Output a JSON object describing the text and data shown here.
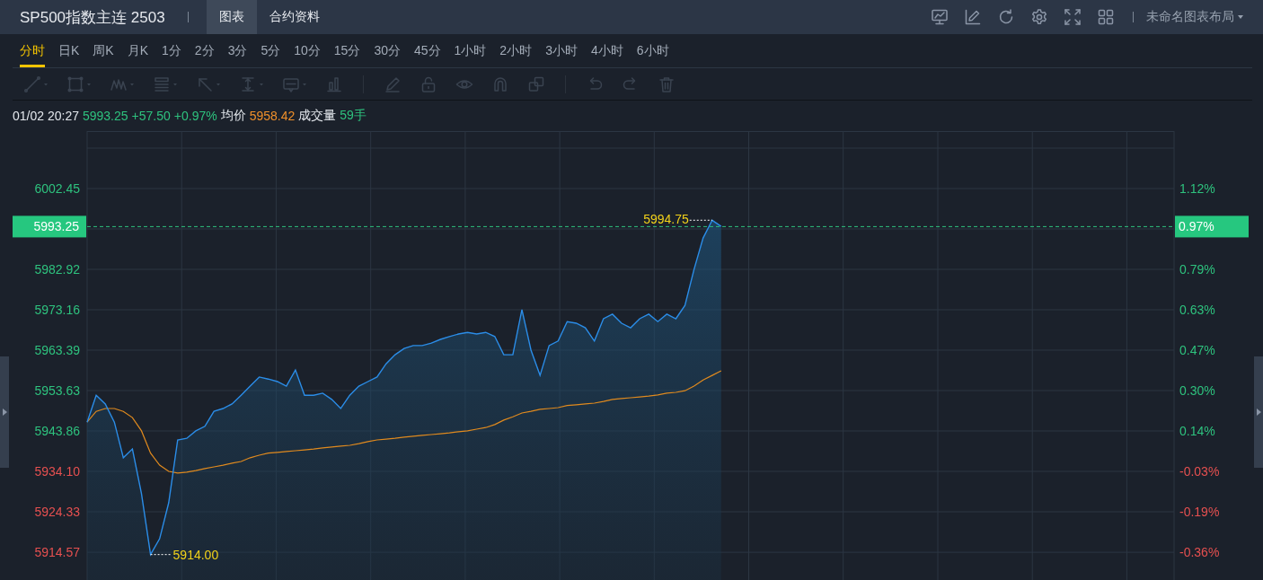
{
  "header": {
    "title": "SP500指数主连 2503",
    "tabs": [
      {
        "label": "图表",
        "selected": true
      },
      {
        "label": "合约资料",
        "selected": false
      }
    ],
    "tools": [
      {
        "kind": "monitor"
      },
      {
        "kind": "draw"
      },
      {
        "kind": "refresh"
      },
      {
        "kind": "settings"
      },
      {
        "kind": "fullscreen"
      },
      {
        "kind": "layout"
      }
    ],
    "layout_menu": "未命名图表布局"
  },
  "periods": [
    {
      "label": "分时",
      "selected": true
    },
    {
      "label": "日K",
      "selected": false
    },
    {
      "label": "周K",
      "selected": false
    },
    {
      "label": "月K",
      "selected": false
    },
    {
      "label": "1分",
      "selected": false
    },
    {
      "label": "2分",
      "selected": false
    },
    {
      "label": "3分",
      "selected": false
    },
    {
      "label": "5分",
      "selected": false
    },
    {
      "label": "10分",
      "selected": false
    },
    {
      "label": "15分",
      "selected": false
    },
    {
      "label": "30分",
      "selected": false
    },
    {
      "label": "45分",
      "selected": false
    },
    {
      "label": "1小时",
      "selected": false
    },
    {
      "label": "2小时",
      "selected": false
    },
    {
      "label": "3小时",
      "selected": false
    },
    {
      "label": "4小时",
      "selected": false
    },
    {
      "label": "6小时",
      "selected": false
    }
  ],
  "drawing_tools": [
    {
      "kind": "line",
      "menu": true
    },
    {
      "kind": "rect",
      "menu": true
    },
    {
      "kind": "wave",
      "menu": true
    },
    {
      "kind": "lines",
      "menu": true
    },
    {
      "kind": "arrow",
      "menu": true
    },
    {
      "kind": "measure",
      "menu": true
    },
    {
      "kind": "note",
      "menu": true
    },
    {
      "kind": "bars",
      "menu": false
    },
    {
      "kind": "divider"
    },
    {
      "kind": "pencil",
      "menu": false
    },
    {
      "kind": "lock",
      "menu": false
    },
    {
      "kind": "eye",
      "menu": false
    },
    {
      "kind": "magnet",
      "menu": false
    },
    {
      "kind": "copy",
      "menu": false
    },
    {
      "kind": "divider"
    },
    {
      "kind": "undo",
      "menu": false
    },
    {
      "kind": "redo",
      "menu": false
    },
    {
      "kind": "trash",
      "menu": false
    }
  ],
  "quote": [
    {
      "text": "01/02 20:27",
      "color": "#e3e7ec"
    },
    {
      "text": "5993.25",
      "color": "#2ec27e"
    },
    {
      "text": "+57.50",
      "color": "#2ec27e"
    },
    {
      "text": "+0.97%",
      "color": "#2ec27e"
    },
    {
      "text": "均价",
      "color": "#e3e7ec"
    },
    {
      "text": "5958.42",
      "color": "#f0902a"
    },
    {
      "text": "成交量",
      "color": "#e3e7ec"
    },
    {
      "text": "59手",
      "color": "#2ec27e"
    }
  ],
  "chart": {
    "chart_data": {
      "type": "area",
      "ylim": [
        5907.85,
        6016.34
      ],
      "grid": true,
      "categories": [
        null,
        null,
        null,
        null,
        null,
        null,
        null,
        null,
        null,
        null,
        null,
        null,
        null,
        null,
        null,
        null,
        null,
        null,
        null,
        null,
        null,
        null,
        null,
        null,
        null,
        null,
        null,
        null,
        null,
        null,
        null,
        null,
        null,
        null,
        null,
        null,
        null,
        null,
        null,
        null,
        null,
        null,
        null,
        null,
        null,
        null,
        null,
        null,
        null,
        null,
        null,
        null,
        null,
        null,
        null,
        null,
        null,
        null,
        null,
        null,
        null,
        null,
        null,
        null,
        null,
        null,
        null,
        null,
        null,
        null,
        null,
        null,
        null,
        null,
        null,
        null,
        null,
        null,
        null,
        null,
        null,
        null,
        null,
        null,
        null,
        null,
        null,
        null,
        null,
        null,
        null,
        null,
        null,
        null,
        null,
        null,
        null,
        null,
        null,
        null,
        null,
        null,
        null,
        null,
        null,
        null,
        null,
        null,
        null,
        null,
        null,
        null,
        null,
        null,
        null,
        null,
        null,
        null,
        null,
        null
      ],
      "series": [
        {
          "color": "#2b8de8",
          "type": "area",
          "values": [
            5946.0,
            5952.5,
            5950.4,
            5946.0,
            5937.4,
            5939.5,
            5928.7,
            5914.0,
            5917.8,
            5926.5,
            5941.7,
            5942.1,
            5943.9,
            5945.0,
            5948.6,
            5949.3,
            5950.4,
            5952.5,
            5954.7,
            5956.9,
            5956.4,
            5955.8,
            5954.7,
            5958.6,
            5952.5,
            5952.5,
            5953.0,
            5951.5,
            5949.3,
            5952.5,
            5954.7,
            5955.8,
            5956.9,
            5960.1,
            5962.3,
            5963.8,
            5964.5,
            5964.5,
            5965.1,
            5966.0,
            5966.7,
            5967.3,
            5967.7,
            5967.3,
            5967.7,
            5966.7,
            5962.3,
            5962.3,
            5973.2,
            5963.4,
            5957.3,
            5964.5,
            5965.6,
            5970.3,
            5969.9,
            5968.8,
            5965.6,
            5971.0,
            5972.1,
            5969.9,
            5968.8,
            5971.0,
            5972.1,
            5970.3,
            5972.1,
            5971.0,
            5974.2,
            5982.9,
            5990.5,
            5994.8,
            5993.3,
            null,
            null,
            null,
            null,
            null,
            null,
            null,
            null,
            null,
            null,
            null,
            null,
            null,
            null,
            null,
            null,
            null,
            null,
            null,
            null,
            null,
            null,
            null,
            null,
            null,
            null,
            null,
            null,
            null,
            null,
            null,
            null,
            null,
            null,
            null,
            null,
            null,
            null,
            null,
            null,
            null,
            null,
            null,
            null,
            null,
            null,
            null,
            null,
            null
          ]
        },
        {
          "color": "#e08a1e",
          "type": "line",
          "values": [
            5946.0,
            5948.6,
            5949.3,
            5949.3,
            5948.6,
            5947.1,
            5943.9,
            5938.5,
            5935.6,
            5934.1,
            5933.7,
            5933.9,
            5934.3,
            5934.8,
            5935.2,
            5935.6,
            5936.1,
            5936.5,
            5937.4,
            5938.0,
            5938.5,
            5938.7,
            5938.9,
            5939.1,
            5939.3,
            5939.5,
            5939.8,
            5940.0,
            5940.2,
            5940.4,
            5940.8,
            5941.3,
            5941.7,
            5941.9,
            5942.1,
            5942.4,
            5942.6,
            5942.8,
            5943.0,
            5943.2,
            5943.4,
            5943.7,
            5943.9,
            5944.3,
            5944.7,
            5945.4,
            5946.5,
            5947.3,
            5948.2,
            5948.6,
            5949.1,
            5949.3,
            5949.5,
            5950.0,
            5950.2,
            5950.4,
            5950.6,
            5951.0,
            5951.5,
            5951.7,
            5951.9,
            5952.1,
            5952.3,
            5952.6,
            5953.0,
            5953.2,
            5953.6,
            5954.7,
            5956.2,
            5957.3,
            5958.4,
            null,
            null,
            null,
            null,
            null,
            null,
            null,
            null,
            null,
            null,
            null,
            null,
            null,
            null,
            null,
            null,
            null,
            null,
            null,
            null,
            null,
            null,
            null,
            null,
            null,
            null,
            null,
            null,
            null,
            null,
            null,
            null,
            null,
            null,
            null,
            null,
            null,
            null,
            null,
            null,
            null,
            null,
            null,
            null,
            null,
            null,
            null,
            null,
            null
          ]
        }
      ],
      "yticks": [
        {
          "value": 6002.45,
          "label": "6002.45"
        },
        {
          "value": 5982.92,
          "label": "5982.92"
        },
        {
          "value": 5973.16,
          "label": "5973.16"
        },
        {
          "value": 5963.39,
          "label": "5963.39"
        },
        {
          "value": 5953.63,
          "label": "5953.63"
        },
        {
          "value": 5943.86,
          "label": "5943.86"
        },
        {
          "value": 5934.1,
          "label": "5934.10"
        },
        {
          "value": 5924.33,
          "label": "5924.33"
        },
        {
          "value": 5914.57,
          "label": "5914.57"
        }
      ],
      "ref_lines": [
        {
          "axis": "y",
          "value": 5993.25,
          "label": "5993.25"
        }
      ],
      "annotations": [
        "5994.75",
        "5914.00"
      ]
    },
    "price_axis": [
      {
        "color": "#2ec27e"
      },
      {
        "color": "#2ec27e"
      },
      {
        "color": "#2ec27e"
      },
      {
        "color": "#2ec27e"
      },
      {
        "color": "#2ec27e"
      },
      {
        "color": "#2ec27e"
      },
      {
        "color": "#e65050"
      },
      {
        "color": "#e65050"
      },
      {
        "color": "#e65050"
      }
    ],
    "last_percent": "0.97%",
    "percent_axis": [
      {
        "label": "1.12%",
        "color": "#2ec27e"
      },
      {
        "label": "0.79%",
        "color": "#2ec27e"
      },
      {
        "label": "0.63%",
        "color": "#2ec27e"
      },
      {
        "label": "0.47%",
        "color": "#2ec27e"
      },
      {
        "label": "0.30%",
        "color": "#2ec27e"
      },
      {
        "label": "0.14%",
        "color": "#2ec27e"
      },
      {
        "label": "-0.03%",
        "color": "#e65050"
      },
      {
        "label": "-0.19%",
        "color": "#e65050"
      },
      {
        "label": "-0.36%",
        "color": "#e65050"
      }
    ]
  }
}
